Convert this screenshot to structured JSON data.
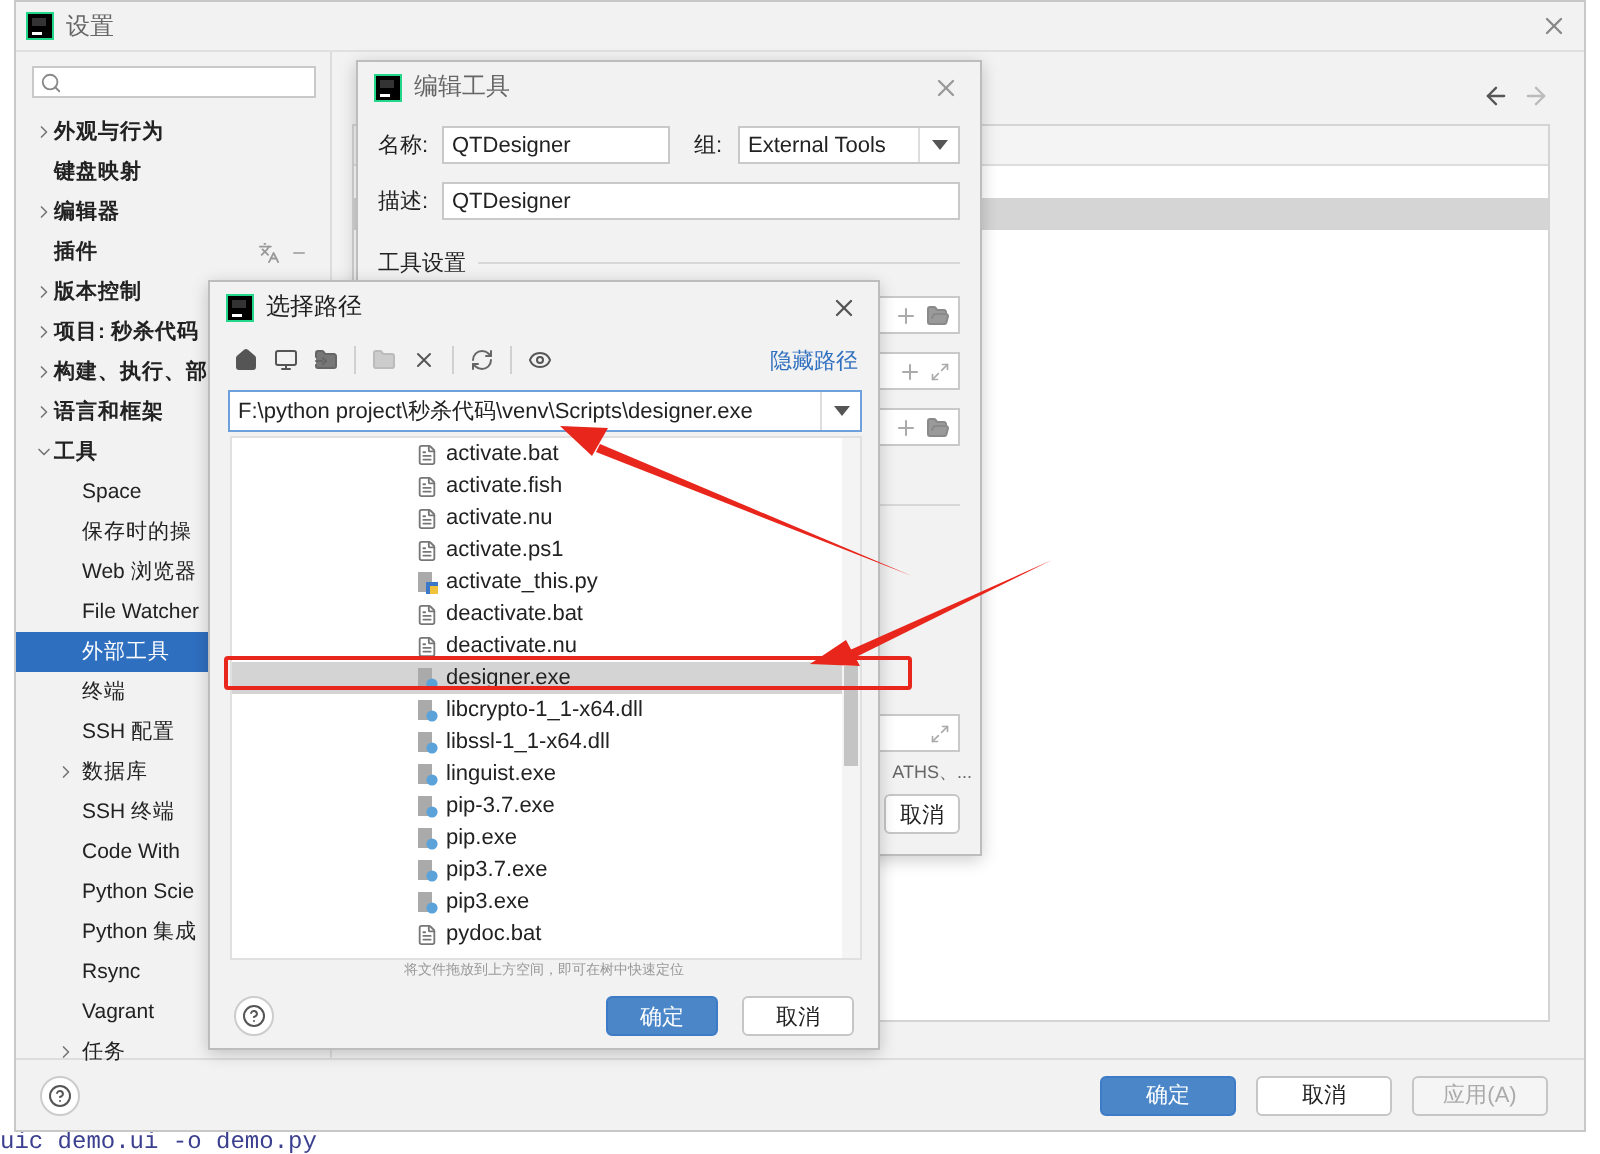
{
  "settings_window": {
    "title": "设置",
    "tree": [
      {
        "label": "外观与行为",
        "kind": "group",
        "expanded": false,
        "selected": false
      },
      {
        "label": "键盘映射",
        "kind": "page",
        "selected": false
      },
      {
        "label": "编辑器",
        "kind": "group",
        "expanded": false,
        "selected": false
      },
      {
        "label": "插件",
        "kind": "plugins",
        "selected": false
      },
      {
        "label": "版本控制",
        "kind": "group",
        "expanded": false,
        "selected": false
      },
      {
        "label": "项目: 秒杀代码",
        "kind": "group",
        "expanded": false,
        "selected": false
      },
      {
        "label": "构建、执行、部",
        "kind": "group",
        "expanded": false,
        "selected": false
      },
      {
        "label": "语言和框架",
        "kind": "group",
        "expanded": false,
        "selected": false
      },
      {
        "label": "工具",
        "kind": "group",
        "expanded": true,
        "selected": false,
        "children": [
          {
            "label": "Space",
            "kind": "page",
            "selected": false
          },
          {
            "label": "保存时的操",
            "kind": "page",
            "selected": false
          },
          {
            "label": "Web 浏览器",
            "kind": "page",
            "selected": false
          },
          {
            "label": "File Watcher",
            "kind": "page",
            "selected": false
          },
          {
            "label": "外部工具",
            "kind": "page",
            "selected": true
          },
          {
            "label": "终端",
            "kind": "page",
            "selected": false
          },
          {
            "label": "SSH 配置",
            "kind": "page",
            "selected": false
          },
          {
            "label": "数据库",
            "kind": "group",
            "expanded": false,
            "selected": false
          },
          {
            "label": "SSH 终端",
            "kind": "page",
            "selected": false
          },
          {
            "label": "Code With",
            "kind": "page",
            "selected": false
          },
          {
            "label": "Python Scie",
            "kind": "page",
            "selected": false
          },
          {
            "label": "Python 集成",
            "kind": "page",
            "selected": false
          },
          {
            "label": "Rsync",
            "kind": "page",
            "selected": false
          },
          {
            "label": "Vagrant",
            "kind": "page",
            "selected": false
          },
          {
            "label": "任务",
            "kind": "group",
            "expanded": false,
            "selected": false
          }
        ]
      }
    ],
    "table_rows": [
      {
        "selected": true
      }
    ],
    "buttons": [
      {
        "label": "确定",
        "kind": "primary",
        "disabled": false
      },
      {
        "label": "取消",
        "kind": "default",
        "disabled": false
      },
      {
        "label": "应用(A)",
        "kind": "default",
        "disabled": true
      }
    ]
  },
  "edit_tool_dialog": {
    "title": "编辑工具",
    "name_label": "名称:",
    "name_value": "QTDesigner",
    "group_label": "组:",
    "group_value": "External Tools",
    "description_label": "描述:",
    "description_value": "QTDesigner",
    "section_title": "工具设置",
    "setting_fields": [
      {
        "kind": "browse"
      },
      {
        "kind": "expand"
      },
      {
        "kind": "browse"
      }
    ],
    "hint": "ATHS、...",
    "buttons": [
      "取消"
    ]
  },
  "choose_path_dialog": {
    "title": "选择路径",
    "hide_path_link": "隐藏路径",
    "path": "F:\\python project\\秒杀代码\\venv\\Scripts\\designer.exe",
    "files": [
      {
        "name": "activate.bat",
        "kind": "script",
        "selected": false
      },
      {
        "name": "activate.fish",
        "kind": "script",
        "selected": false
      },
      {
        "name": "activate.nu",
        "kind": "script",
        "selected": false
      },
      {
        "name": "activate.ps1",
        "kind": "script",
        "selected": false
      },
      {
        "name": "activate_this.py",
        "kind": "python",
        "selected": false
      },
      {
        "name": "deactivate.bat",
        "kind": "script",
        "selected": false
      },
      {
        "name": "deactivate.nu",
        "kind": "script",
        "selected": false
      },
      {
        "name": "designer.exe",
        "kind": "binary",
        "selected": true
      },
      {
        "name": "libcrypto-1_1-x64.dll",
        "kind": "binary",
        "selected": false
      },
      {
        "name": "libssl-1_1-x64.dll",
        "kind": "binary",
        "selected": false
      },
      {
        "name": "linguist.exe",
        "kind": "binary",
        "selected": false
      },
      {
        "name": "pip-3.7.exe",
        "kind": "binary",
        "selected": false
      },
      {
        "name": "pip.exe",
        "kind": "binary",
        "selected": false
      },
      {
        "name": "pip3.7.exe",
        "kind": "binary",
        "selected": false
      },
      {
        "name": "pip3.exe",
        "kind": "binary",
        "selected": false
      },
      {
        "name": "pydoc.bat",
        "kind": "script",
        "selected": false
      }
    ],
    "drop_hint": "将文件拖放到上方空间，即可在树中快速定位",
    "buttons": [
      {
        "label": "确定",
        "kind": "primary"
      },
      {
        "label": "取消",
        "kind": "default"
      }
    ]
  },
  "editor_line": "uic demo.ui -o demo.py"
}
